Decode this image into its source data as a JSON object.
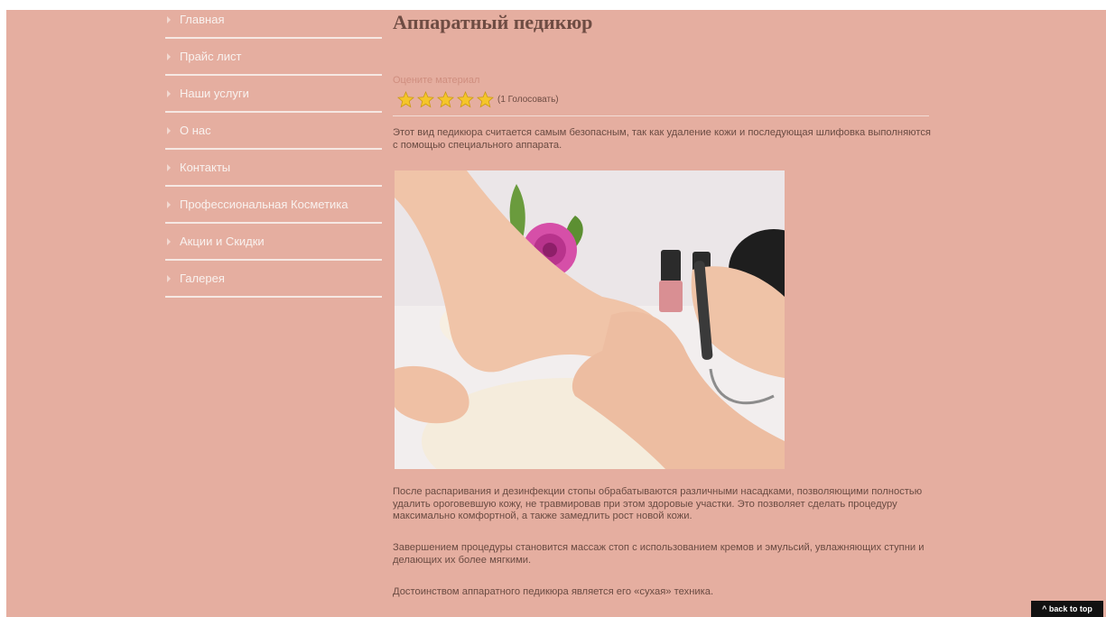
{
  "nav": {
    "items": [
      {
        "label": "Главная"
      },
      {
        "label": "Прайс лист"
      },
      {
        "label": "Наши услуги"
      },
      {
        "label": "О нас"
      },
      {
        "label": "Контакты"
      },
      {
        "label": "Профессиональная Косметика"
      },
      {
        "label": "Акции и Скидки"
      },
      {
        "label": "Галерея"
      }
    ]
  },
  "article": {
    "title": "Аппаратный педикюр",
    "rate_label": "Оцените материал",
    "rating": {
      "value": 5,
      "max": 5,
      "votes_text": "(1 Голосовать)"
    },
    "intro": "Этот вид педикюра считается самым безопасным, так как удаление кожи и последующая шлифовка выполняются с помощью специального аппарата.",
    "p1": "После распаривания и дезинфекции стопы обрабатываются различными насадками, позволяющими полностью удалить ороговевшую кожу, не травмировав при этом здоровые участки. Это позволяет сделать процедуру максимально комфортной, а также замедлить рост новой кожи.",
    "p2": "Завершением процедуры становится массаж стоп с использованием кремов и эмульсий, увлажняющих ступни и делающих их более мягкими.",
    "p3": "Достоинством аппаратного педикюра является его «сухая» техника."
  },
  "back_to_top": "^ back to top",
  "colors": {
    "background": "#e5aea0",
    "star": "#f5c52a"
  }
}
